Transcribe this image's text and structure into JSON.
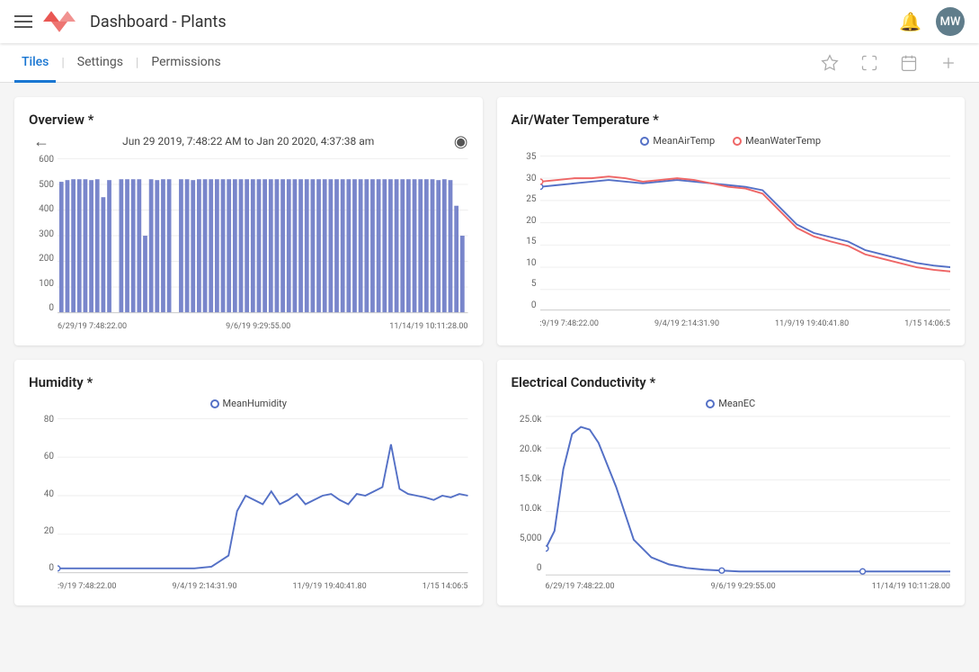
{
  "header": {
    "title": "Dashboard - Plants",
    "avatar_initials": "MW"
  },
  "nav": {
    "tabs": [
      {
        "label": "Tiles",
        "active": true
      },
      {
        "label": "Settings",
        "active": false
      },
      {
        "label": "Permissions",
        "active": false
      }
    ],
    "actions": [
      "star",
      "fullscreen",
      "calendar",
      "add"
    ]
  },
  "tiles": [
    {
      "id": "overview",
      "title": "Overview *",
      "date_range": "Jun 29 2019, 7:48:22 AM to Jan 20 2020, 4:37:38 am",
      "type": "bar",
      "x_labels": [
        "6/29/19 7:48:22.00",
        "9/6/19 9:29:55.00",
        "11/14/19 10:11:28.00"
      ],
      "y_labels": [
        "600",
        "500",
        "400",
        "300",
        "200",
        "100",
        "0"
      ]
    },
    {
      "id": "airwater",
      "title": "Air/Water Temperature *",
      "type": "line",
      "legend": [
        {
          "label": "MeanAirTemp",
          "color": "#5470c6"
        },
        {
          "label": "MeanWaterTemp",
          "color": "#ee6666"
        }
      ],
      "x_labels": [
        ":9/19 7:48:22.00",
        "9/4/19 2:14:31.90",
        "11/9/19 19:40:41.80",
        "1/15 14:06:5"
      ],
      "y_labels": [
        "35",
        "30",
        "25",
        "20",
        "15",
        "10",
        "5",
        "0"
      ]
    },
    {
      "id": "humidity",
      "title": "Humidity *",
      "type": "line",
      "legend": [
        {
          "label": "MeanHumidity",
          "color": "#5470c6"
        }
      ],
      "x_labels": [
        ":9/19 7:48:22.00",
        "9/4/19 2:14:31.90",
        "11/9/19 19:40:41.80",
        "1/15 14:06:5"
      ],
      "y_labels": [
        "80",
        "60",
        "40",
        "20",
        "0"
      ]
    },
    {
      "id": "conductivity",
      "title": "Electrical Conductivity *",
      "type": "line",
      "legend": [
        {
          "label": "MeanEC",
          "color": "#5470c6"
        }
      ],
      "x_labels": [
        "6/29/19 7:48:22.00",
        "9/6/19 9:29:55.00",
        "11/14/19 10:11:28.00"
      ],
      "y_labels": [
        "25.0k",
        "20.0k",
        "15.0k",
        "10.0k",
        "5,000",
        "0"
      ]
    }
  ]
}
